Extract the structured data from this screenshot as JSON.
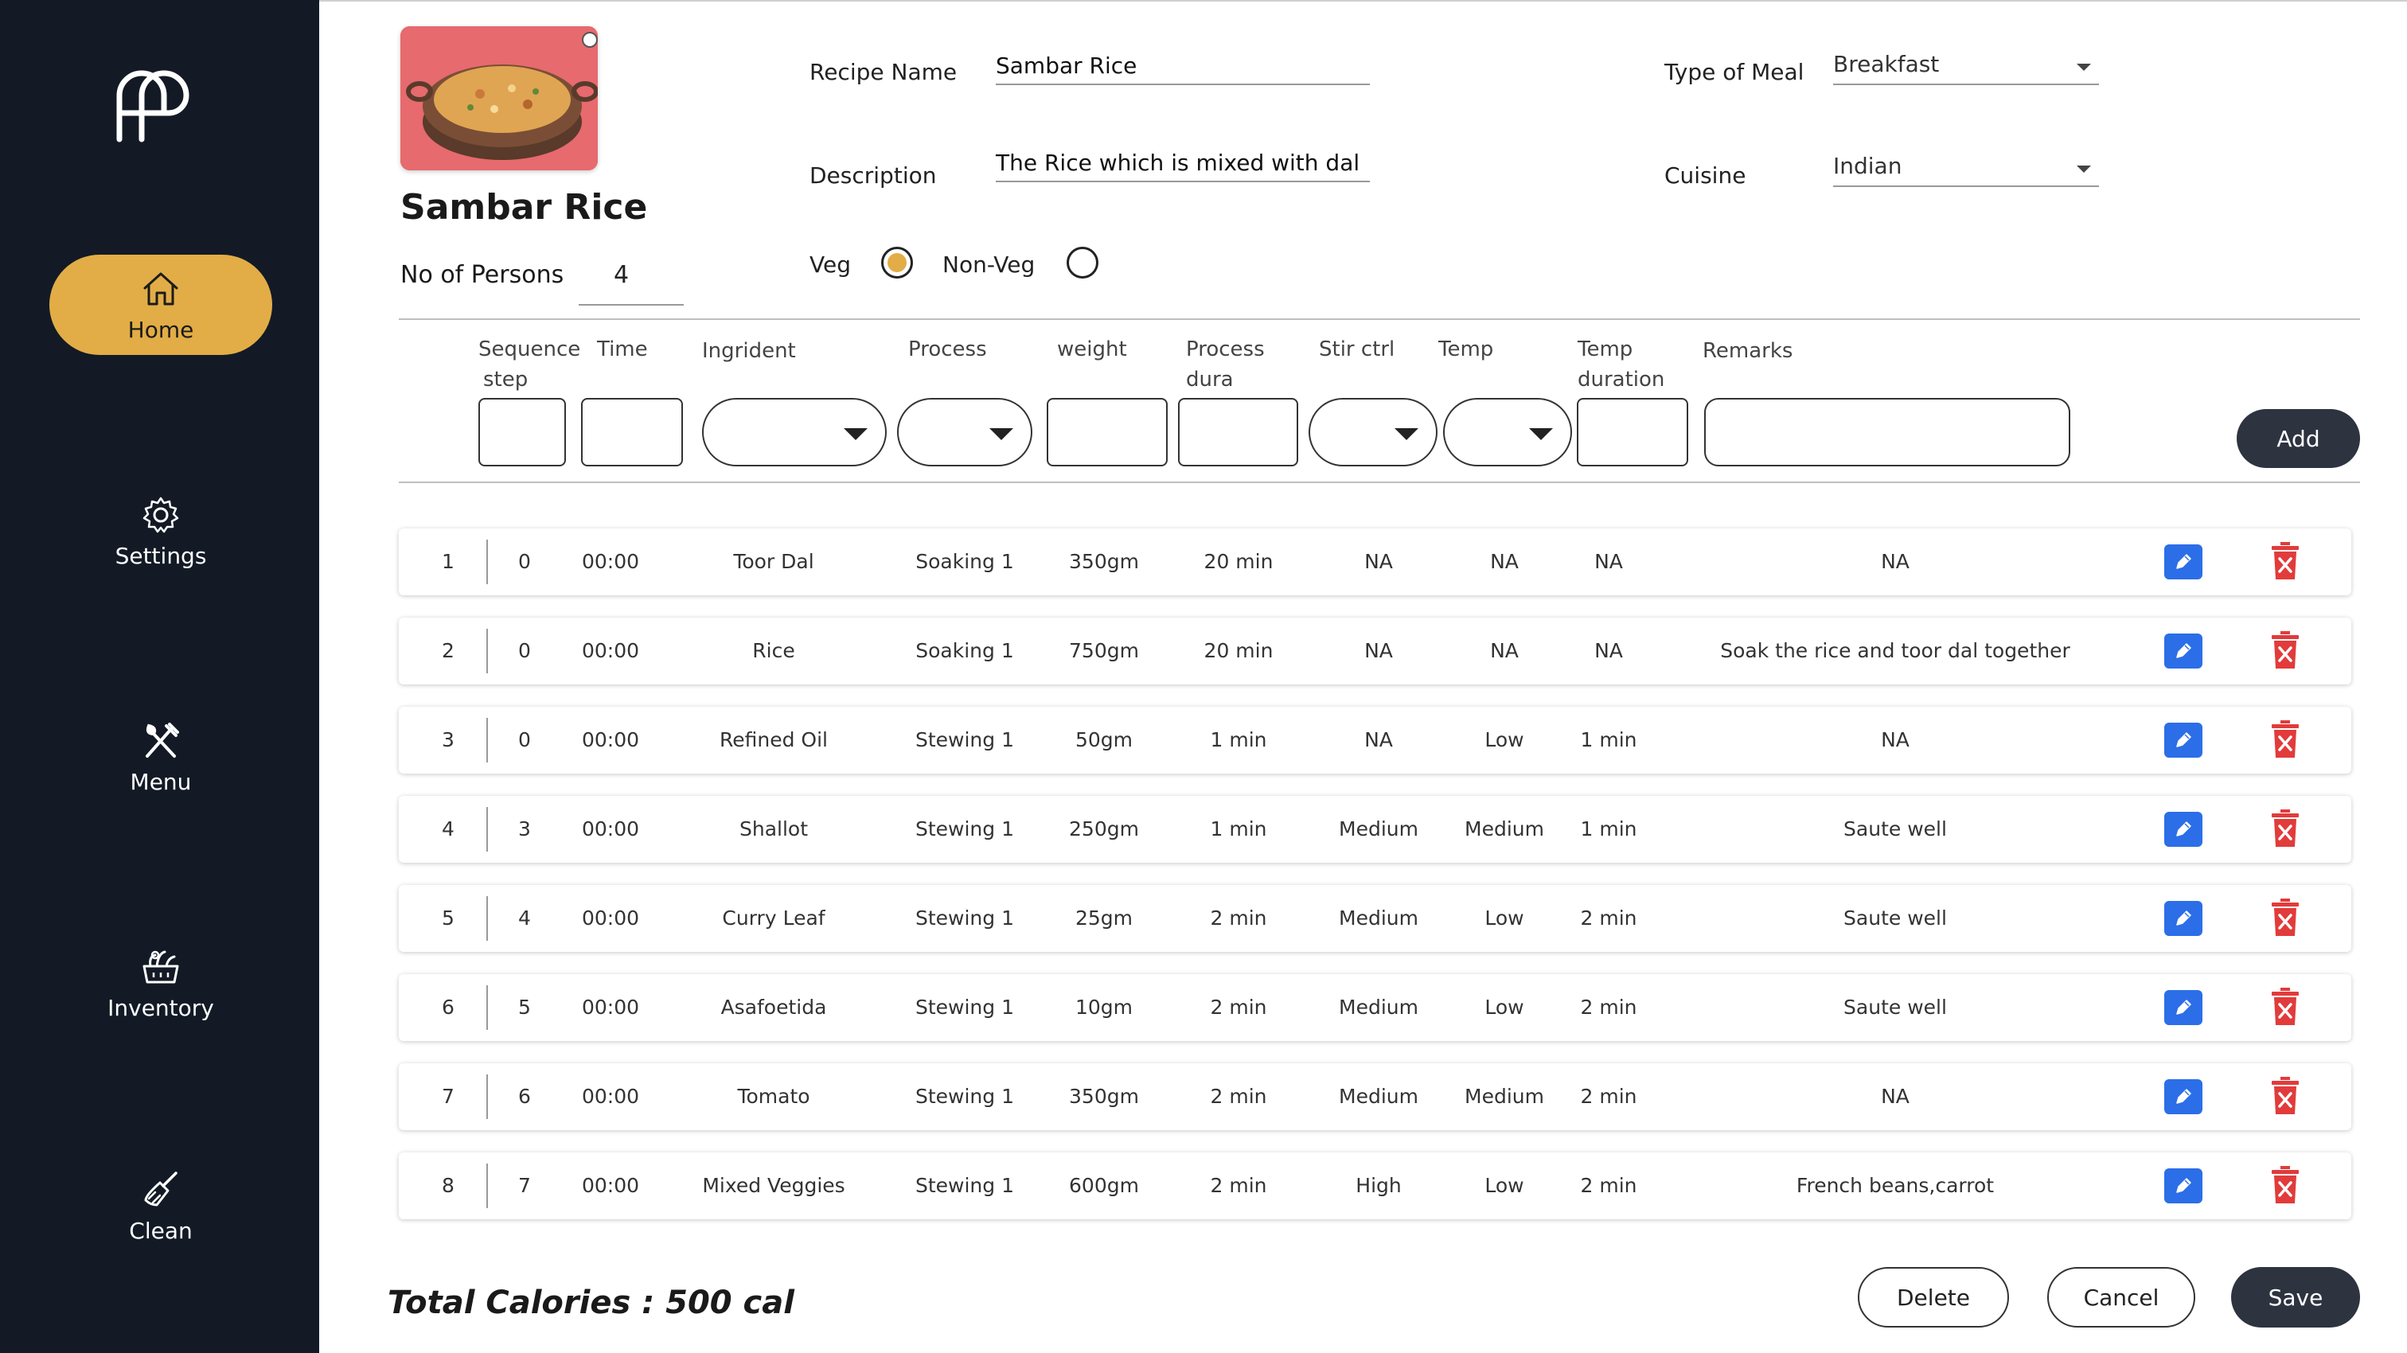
{
  "sidebar": {
    "logo_alt": "",
    "items": [
      {
        "label": "Home",
        "icon": "home-icon",
        "active": true
      },
      {
        "label": "Settings",
        "icon": "gear-icon",
        "active": false
      },
      {
        "label": "Menu",
        "icon": "fork-knife-icon",
        "active": false
      },
      {
        "label": "Inventory",
        "icon": "basket-icon",
        "active": false
      },
      {
        "label": "Clean",
        "icon": "broom-icon",
        "active": false
      }
    ]
  },
  "recipe": {
    "title": "Sambar Rice",
    "persons_label": "No of Persons",
    "persons_value": "4",
    "name_label": "Recipe Name",
    "name_value": "Sambar Rice",
    "description_label": "Description",
    "description_value": "The Rice which is mixed with dal",
    "meal_type_label": "Type of Meal",
    "meal_type_value": "Breakfast",
    "cuisine_label": "Cuisine",
    "cuisine_value": "Indian",
    "veg_label": "Veg",
    "nonveg_label": "Non-Veg",
    "veg_selected": true
  },
  "entry": {
    "columns": [
      "Sequence",
      "step",
      "Time",
      "Ingrident",
      "Process",
      "weight",
      "Process",
      "dura",
      "Stir ctrl",
      "Temp",
      "Temp",
      "duration",
      "Remarks"
    ],
    "add_label": "Add"
  },
  "steps": [
    {
      "seq": "1",
      "step": "0",
      "time": "00:00",
      "ingredient": "Toor Dal",
      "process": "Soaking 1",
      "weight": "350gm",
      "duration": "20 min",
      "stir": "NA",
      "temp": "NA",
      "temp_duration": "NA",
      "remarks": "NA"
    },
    {
      "seq": "2",
      "step": "0",
      "time": "00:00",
      "ingredient": "Rice",
      "process": "Soaking 1",
      "weight": "750gm",
      "duration": "20 min",
      "stir": "NA",
      "temp": "NA",
      "temp_duration": "NA",
      "remarks": "Soak the rice and toor dal together"
    },
    {
      "seq": "3",
      "step": "0",
      "time": "00:00",
      "ingredient": "Refined Oil",
      "process": "Stewing 1",
      "weight": "50gm",
      "duration": "1 min",
      "stir": "NA",
      "temp": "Low",
      "temp_duration": "1 min",
      "remarks": "NA"
    },
    {
      "seq": "4",
      "step": "3",
      "time": "00:00",
      "ingredient": "Shallot",
      "process": "Stewing 1",
      "weight": "250gm",
      "duration": "1 min",
      "stir": "Medium",
      "temp": "Medium",
      "temp_duration": "1 min",
      "remarks": "Saute well"
    },
    {
      "seq": "5",
      "step": "4",
      "time": "00:00",
      "ingredient": "Curry Leaf",
      "process": "Stewing 1",
      "weight": "25gm",
      "duration": "2 min",
      "stir": "Medium",
      "temp": "Low",
      "temp_duration": "2 min",
      "remarks": "Saute well"
    },
    {
      "seq": "6",
      "step": "5",
      "time": "00:00",
      "ingredient": "Asafoetida",
      "process": "Stewing 1",
      "weight": "10gm",
      "duration": "2 min",
      "stir": "Medium",
      "temp": "Low",
      "temp_duration": "2 min",
      "remarks": "Saute well"
    },
    {
      "seq": "7",
      "step": "6",
      "time": "00:00",
      "ingredient": "Tomato",
      "process": "Stewing 1",
      "weight": "350gm",
      "duration": "2 min",
      "stir": "Medium",
      "temp": "Medium",
      "temp_duration": "2 min",
      "remarks": "NA"
    },
    {
      "seq": "8",
      "step": "7",
      "time": "00:00",
      "ingredient": "Mixed Veggies",
      "process": "Stewing  1",
      "weight": "600gm",
      "duration": "2 min",
      "stir": "High",
      "temp": "Low",
      "temp_duration": "2 min",
      "remarks": "French beans,carrot"
    }
  ],
  "footer": {
    "total_calories": "Total Calories : 500 cal",
    "delete_label": "Delete",
    "cancel_label": "Cancel",
    "save_label": "Save"
  },
  "colors": {
    "sidebar_bg": "#131a26",
    "accent": "#e2ad46",
    "edit_blue": "#2b6ee8",
    "delete_red": "#e23b3b",
    "dark_button": "#2d333f"
  }
}
